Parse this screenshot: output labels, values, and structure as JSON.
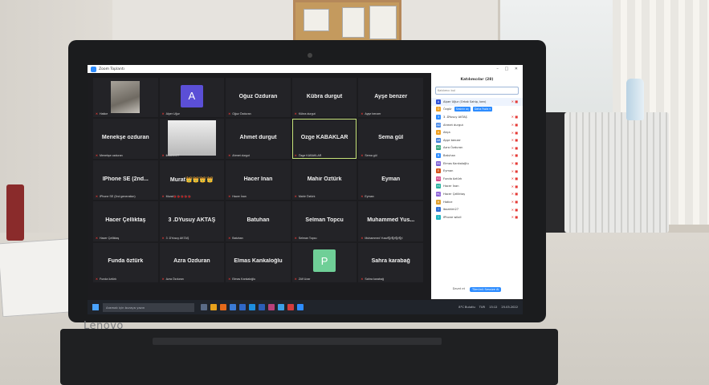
{
  "laptop": {
    "brand": "Lenovo"
  },
  "window": {
    "title": "Zoom Toplantı",
    "controls": "–  □  ✕"
  },
  "grid": {
    "tiles": [
      {
        "big": "",
        "small": "Hatice",
        "mic": "red"
      },
      {
        "big": "",
        "small": "Alper Uğur",
        "avatar_letter": "A",
        "avatar_color": "#5b4fd6"
      },
      {
        "big": "Oğuz Özduran",
        "small": "Oğuz Özduran"
      },
      {
        "big": "Kübra durgut",
        "small": "Kübra durgut"
      },
      {
        "big": "Ayşe benzer",
        "small": "Ayşe benzer"
      },
      {
        "big": "Menekşe ozduran",
        "small": "Menekşe ozduran"
      },
      {
        "big": "",
        "small": "iboahim27"
      },
      {
        "big": "Ahmet durgut",
        "small": "Ahmet durgut"
      },
      {
        "big": "Özge KABAKLAR",
        "small": "Özge KABAKLAR",
        "active": true
      },
      {
        "big": "Sema gül",
        "small": "Sema gül"
      },
      {
        "big": "IPhone SE (2nd...",
        "small": "IPhone SE (2nd generation)"
      },
      {
        "big": "Murat👑👑👑👑",
        "small": "Murat🐞🐞🐞🐞🐞"
      },
      {
        "big": "Hacer İnan",
        "small": "Hacer İnan"
      },
      {
        "big": "Mahir Öztürk",
        "small": "Mahir Öztürk"
      },
      {
        "big": "Eyman",
        "small": "Eyman"
      },
      {
        "big": "Hacer Çelliktaş",
        "small": "Hacer Çelliktaş"
      },
      {
        "big": "3 .DYusuy AKTAŞ",
        "small": "3 .DYusuy AKTAŞ"
      },
      {
        "big": "Batuhan",
        "small": "Batuhan"
      },
      {
        "big": "Selman Topcu",
        "small": "Selman Topcu"
      },
      {
        "big": "Muhammed Yus...",
        "small": "Muhammed Yusuf🐿🐿🐿🐿"
      },
      {
        "big": "Funda öztürk",
        "small": "Funda öztürk"
      },
      {
        "big": "Azra Özduran",
        "small": "Azra Özduran"
      },
      {
        "big": "Elmas Kankaloğlu",
        "small": "Elmas Kankaloğlu"
      },
      {
        "big": "",
        "small": "Zülf Uzar",
        "avatar_letter": "P",
        "avatar_color": "#6fcf97"
      },
      {
        "big": "Sahra karabağ",
        "small": "Sahra karabağ"
      }
    ]
  },
  "participants": {
    "title": "Katılımcılar (28)",
    "search_placeholder": "Katılımcı bul",
    "rows": [
      {
        "name": "Alper Uğur (Ortak Sahip, ben)",
        "initial": "A",
        "color": "#2d4fd6",
        "host": true
      },
      {
        "name": "Özgür",
        "initial": "Ö",
        "color": "#f0a020",
        "btn1": "Sesinin aç",
        "btn2": "Daha Fazla ▾"
      },
      {
        "name": "3 .DYusuy AKTAŞ",
        "initial": "3",
        "color": "#2d8cff"
      },
      {
        "name": "Ahmet durgut",
        "initial": "AD",
        "color": "#4a8be8"
      },
      {
        "name": "Akça",
        "initial": "A",
        "color": "#f0a020"
      },
      {
        "name": "Ayşe benzer",
        "initial": "AB",
        "color": "#3f7fd9"
      },
      {
        "name": "Azra Özduran",
        "initial": "AÖ",
        "color": "#31a57a"
      },
      {
        "name": "Batuhan",
        "initial": "B",
        "color": "#2d8cff"
      },
      {
        "name": "Elmas Kankaloğlu",
        "initial": "EK",
        "color": "#7c5fd6"
      },
      {
        "name": "Eyman",
        "initial": "E",
        "color": "#d6541a"
      },
      {
        "name": "Funda öztürk",
        "initial": "FÖ",
        "color": "#d64a8b"
      },
      {
        "name": "Hacer İnan",
        "initial": "Hİ",
        "color": "#2ab3a0"
      },
      {
        "name": "Hacer Çelliktaş",
        "initial": "HÇ",
        "color": "#8b5fd6"
      },
      {
        "name": "Hatice",
        "initial": "H",
        "color": "#e0a030"
      },
      {
        "name": "iboahim27",
        "initial": "İ",
        "color": "#2d6fd6"
      },
      {
        "name": "IPhone wiloll",
        "initial": "İ",
        "color": "#1fb5c2"
      }
    ],
    "footer_invite": "Davet et",
    "footer_mute": "Tümünü Sessize Al"
  },
  "taskbar": {
    "search": "Aramak için buraya yazın",
    "weather": "8°C Bulutlu",
    "time": "13:12",
    "date": "25.03.2022",
    "lang": "TUR"
  }
}
